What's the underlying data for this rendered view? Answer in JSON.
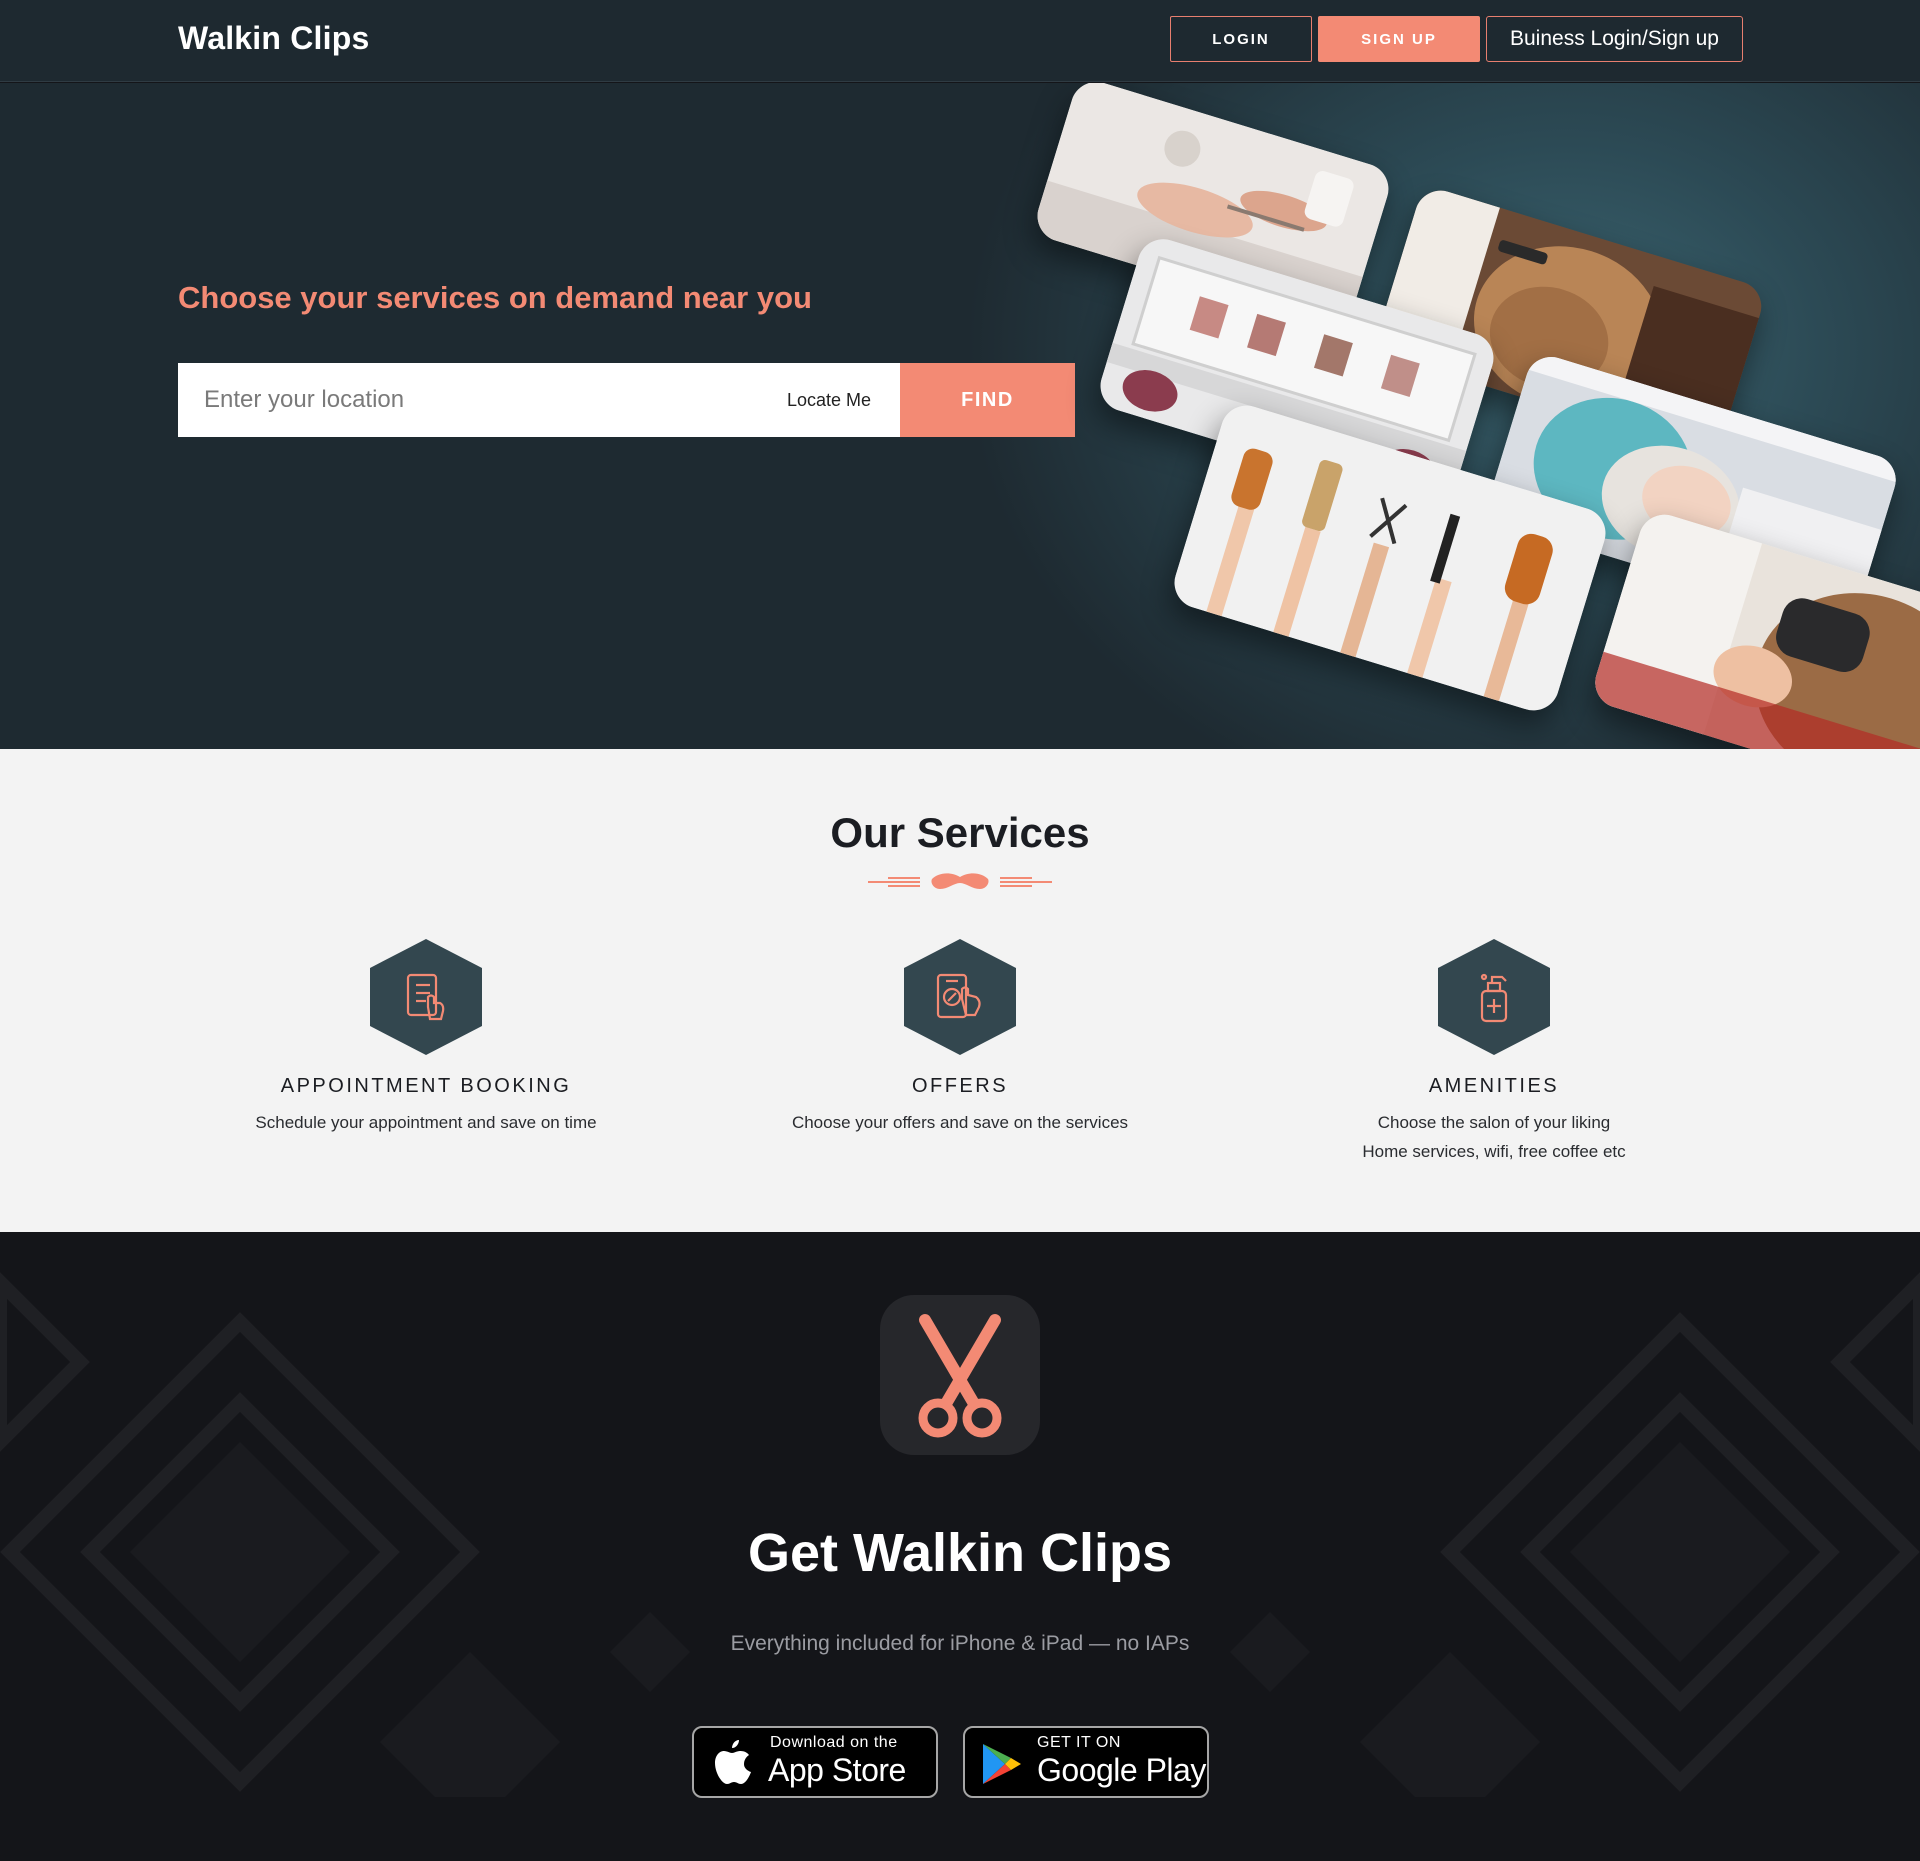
{
  "navbar": {
    "brand": "Walkin Clips",
    "login_label": "LOGIN",
    "signup_label": "SIGN UP",
    "business_label": "Buiness Login/Sign up"
  },
  "hero": {
    "title": "Choose your services on demand near you",
    "search_placeholder": "Enter your location",
    "search_value": "",
    "locate_label": "Locate Me",
    "find_label": "FIND"
  },
  "services": {
    "title": "Our Services",
    "items": [
      {
        "icon": "checklist-phone-icon",
        "title": "APPOINTMENT BOOKING",
        "desc_line1": "Schedule your appointment and save on time",
        "desc_line2": ""
      },
      {
        "icon": "offer-phone-icon",
        "title": "OFFERS",
        "desc_line1": "Choose your offers and save on the services",
        "desc_line2": ""
      },
      {
        "icon": "sanitizer-bottle-icon",
        "title": "AMENITIES",
        "desc_line1": "Choose the salon of your liking",
        "desc_line2": "Home services, wifi, free coffee etc"
      }
    ]
  },
  "app": {
    "title": "Get Walkin Clips",
    "subtitle": "Everything included for iPhone & iPad — no IAPs",
    "apple_small": "Download on the",
    "apple_big": "App Store",
    "google_small": "GET IT ON",
    "google_big": "Google Play"
  },
  "colors": {
    "accent": "#f38a74",
    "navbar_bg": "#1e2930",
    "hero_bg": "#1e2a31",
    "services_bg": "#f3f3f3",
    "hexagon": "#33474f",
    "footer_bg": "#141519"
  }
}
